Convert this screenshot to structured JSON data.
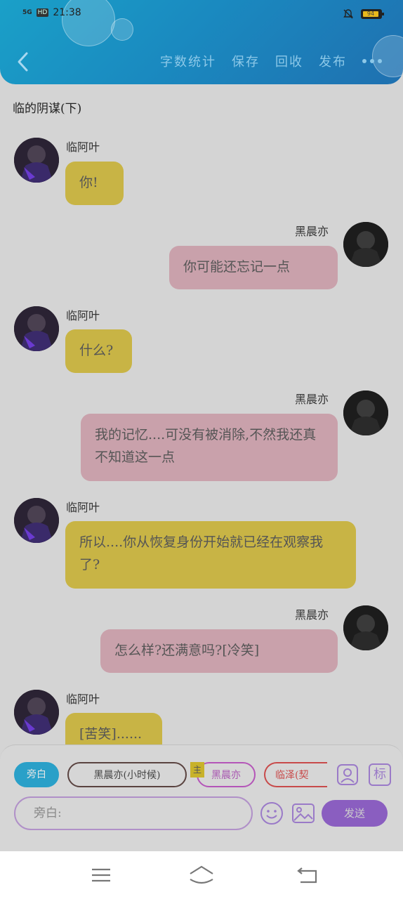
{
  "status": {
    "signal": "5G",
    "hd": "HD",
    "time": "21:38",
    "battery": "94"
  },
  "header": {
    "actions": [
      "字数统计",
      "保存",
      "回收",
      "发布"
    ]
  },
  "story": {
    "title": "临的阴谋(下)"
  },
  "messages": [
    {
      "side": "left",
      "name": "临阿叶",
      "text": "你!"
    },
    {
      "side": "right",
      "name": "黑晨亦",
      "text": "你可能还忘记一点"
    },
    {
      "side": "left",
      "name": "临阿叶",
      "text": "什么?"
    },
    {
      "side": "right",
      "name": "黑晨亦",
      "text": "我的记忆....可没有被消除,不然我还真不知道这一点"
    },
    {
      "side": "left",
      "name": "临阿叶",
      "text": "所以....你从恢复身份开始就已经在观察我了?"
    },
    {
      "side": "right",
      "name": "黑晨亦",
      "text": "怎么样?还满意吗?[冷笑]"
    },
    {
      "side": "left",
      "name": "临阿叶",
      "text": "[苦笑]......"
    }
  ],
  "composer": {
    "narration_chip": "旁白",
    "role_chips": [
      "黑晨亦(小时候)",
      "黑晨亦",
      "临泽(契"
    ],
    "badge": "主",
    "input_placeholder": "旁白:",
    "send_label": "发送",
    "tag_icon_label": "标"
  },
  "colors": {
    "header": "#1a8ac0",
    "left_bubble": "#c8b445",
    "right_bubble": "#c9a1ab",
    "send": "#8a5ec0"
  }
}
